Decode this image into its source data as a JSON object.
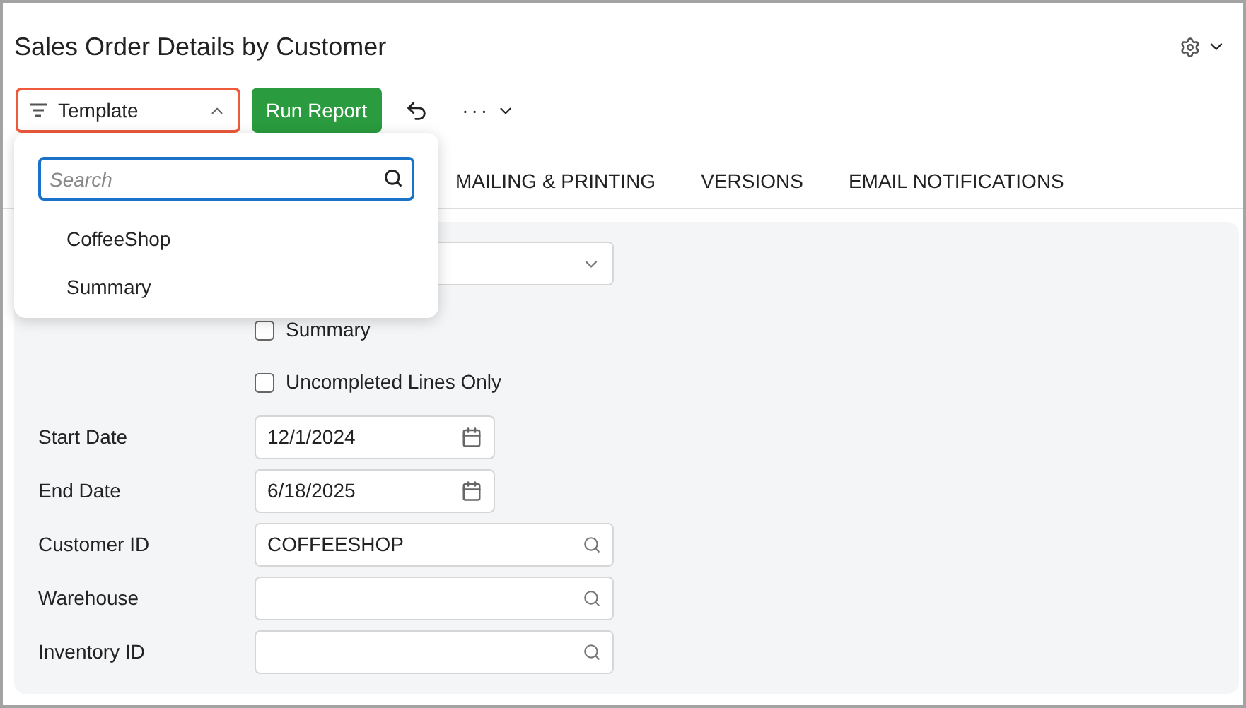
{
  "title": "Sales Order Details by Customer",
  "toolbar": {
    "template_button": "Template",
    "run_button": "Run Report",
    "more_button": "···"
  },
  "template_menu": {
    "search": {
      "placeholder": "Search"
    },
    "items": [
      "CoffeeShop",
      "Summary"
    ]
  },
  "tabs": [
    {
      "label": "MAILING & PRINTING"
    },
    {
      "label": "VERSIONS"
    },
    {
      "label": "EMAIL NOTIFICATIONS"
    }
  ],
  "form": {
    "checkboxes": [
      {
        "label": "Summary",
        "checked": false
      },
      {
        "label": "Uncompleted Lines Only",
        "checked": false
      }
    ],
    "fields": [
      {
        "label": "Start Date",
        "value": "12/1/2024",
        "kind": "date"
      },
      {
        "label": "End Date",
        "value": "6/18/2025",
        "kind": "date"
      },
      {
        "label": "Customer ID",
        "value": "COFFEESHOP",
        "kind": "lookup"
      },
      {
        "label": "Warehouse",
        "kind": "lookup"
      },
      {
        "label": "Inventory ID",
        "kind": "lookup"
      }
    ]
  }
}
